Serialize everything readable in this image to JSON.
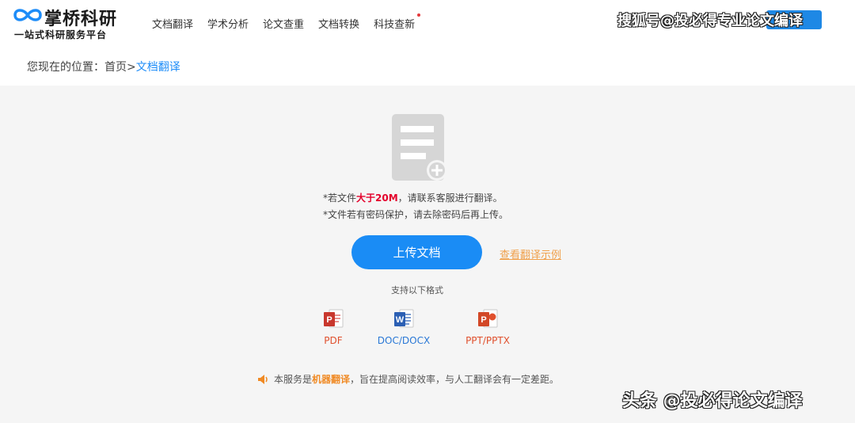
{
  "header": {
    "logo_name": "掌桥科研",
    "logo_slogan": "一站式科研服务平台",
    "nav": [
      "文档翻译",
      "学术分析",
      "论文查重",
      "文档转换",
      "科技查新"
    ],
    "overlay_text": "搜狐号@投必得专业论文编译"
  },
  "breadcrumb": {
    "prefix": "您现在的位置：",
    "home": "首页",
    "separator": ">",
    "current": "文档翻译"
  },
  "upload": {
    "note1_before": "*若文件",
    "note1_highlight": "大于20M",
    "note1_after": "，请联系客服进行翻译。",
    "note2": "*文件若有密码保护，请去除密码后再上传。",
    "button": "上传文档",
    "example_link": "查看翻译示例"
  },
  "formats": {
    "title": "支持以下格式",
    "items": [
      {
        "label": "PDF",
        "icon": "pdf-file-icon"
      },
      {
        "label": "DOC/DOCX",
        "icon": "word-file-icon"
      },
      {
        "label": "PPT/PPTX",
        "icon": "powerpoint-file-icon"
      }
    ]
  },
  "disclaimer": {
    "before": "本服务是",
    "highlight": "机器翻译",
    "after": "，旨在提高阅读效率，与人工翻译会有一定差距。"
  },
  "watermark": "头条 @投必得论文编译",
  "colors": {
    "primary": "#1a8cf5",
    "highlight_red": "#e4002b",
    "accent_orange": "#f08a24",
    "panel_bg": "#f5f5f5"
  }
}
